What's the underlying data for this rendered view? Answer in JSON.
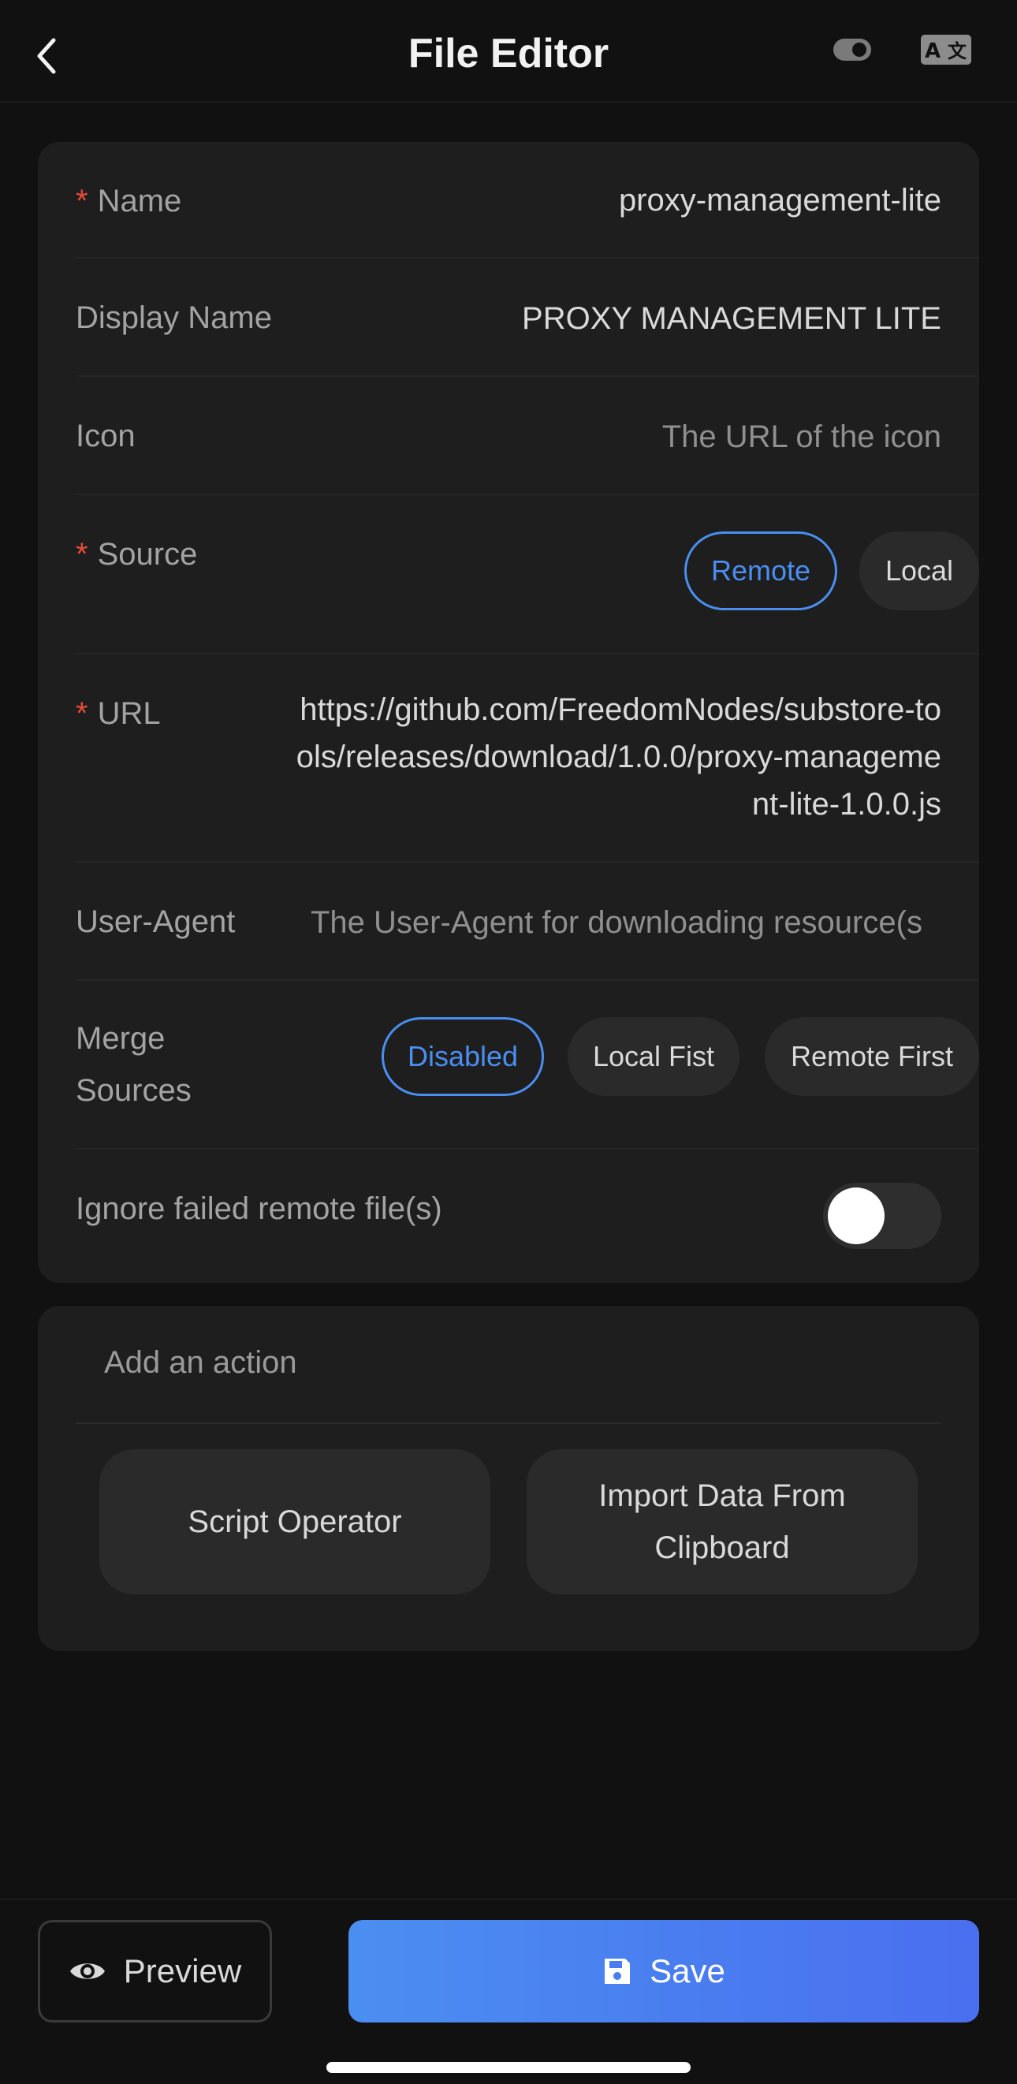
{
  "header": {
    "title": "File Editor",
    "lang_icon_text": "A文"
  },
  "form": {
    "name": {
      "label": "Name",
      "required_mark": "*",
      "value": "proxy-management-lite"
    },
    "display_name": {
      "label": "Display Name",
      "value": "PROXY MANAGEMENT LITE"
    },
    "icon": {
      "label": "Icon",
      "placeholder": "The URL of the icon"
    },
    "source": {
      "label": "Source",
      "required_mark": "*",
      "options": [
        "Remote",
        "Local"
      ],
      "selected": "Remote"
    },
    "url": {
      "label": "URL",
      "required_mark": "*",
      "value": "https://github.com/FreedomNodes/substore-tools/releases/download/1.0.0/proxy-management-lite-1.0.0.js"
    },
    "user_agent": {
      "label": "User-Agent",
      "placeholder": "The User-Agent for downloading resource(s"
    },
    "merge_sources": {
      "label": "Merge Sources",
      "options": [
        "Disabled",
        "Local Fist",
        "Remote First"
      ],
      "selected": "Disabled"
    },
    "ignore_failed": {
      "label": "Ignore failed remote file(s)",
      "enabled": false
    }
  },
  "actions": {
    "title": "Add an action",
    "buttons": [
      "Script Operator",
      "Import Data From Clipboard"
    ]
  },
  "bottom": {
    "preview_label": "Preview",
    "save_label": "Save"
  },
  "colors": {
    "accent": "#4a8ef0",
    "required": "#e6493a",
    "background": "#111111",
    "card": "#1e1e1e"
  },
  "icons": [
    "chevron-left-icon",
    "theme-toggle-icon",
    "translate-icon",
    "eye-icon",
    "save-icon"
  ]
}
